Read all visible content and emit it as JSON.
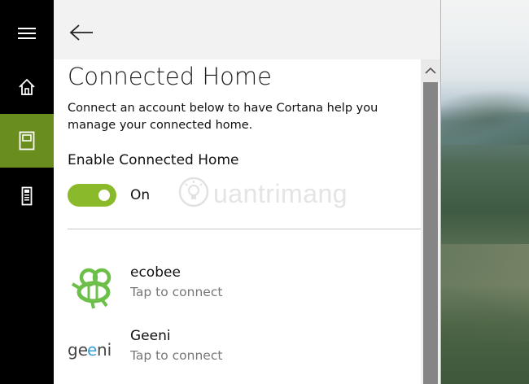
{
  "nav": {
    "items": [
      {
        "name": "menu",
        "icon": "hamburger-menu-icon"
      },
      {
        "name": "home",
        "icon": "home-icon"
      },
      {
        "name": "notebook",
        "icon": "notebook-icon",
        "active": true
      },
      {
        "name": "device",
        "icon": "device-icon"
      }
    ],
    "active_color": "#6a8e1e"
  },
  "header": {
    "back_icon": "back-arrow-icon"
  },
  "page": {
    "title": "Connected Home",
    "description": "Connect an account below to have Cortana help you manage your connected home.",
    "enable_label": "Enable Connected Home",
    "toggle_state": "On",
    "toggle_color": "#8ab92c",
    "watermark": "uantrimang"
  },
  "services": [
    {
      "name": "ecobee",
      "status": "Tap to connect",
      "icon": "ecobee-bee-logo",
      "brand_color": "#6cc04a"
    },
    {
      "name": "Geeni",
      "status": "Tap to connect",
      "logo_text": "geeni",
      "brand_color": "#3aa0d8"
    }
  ],
  "scrollbar": {
    "up_icon": "chevron-up-icon"
  }
}
